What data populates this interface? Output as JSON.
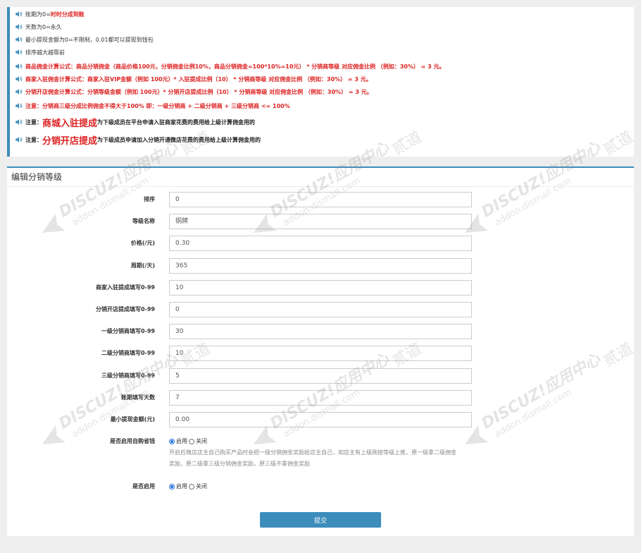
{
  "notices": [
    {
      "parts": [
        {
          "t": "账期为0=",
          "s": "normal"
        },
        {
          "t": "时时分成到账",
          "s": "red"
        }
      ]
    },
    {
      "parts": [
        {
          "t": "天数为0=永久",
          "s": "normal"
        }
      ]
    },
    {
      "parts": [
        {
          "t": "最小提现金额为0=不限制，0.01都可以提现到钱包",
          "s": "normal"
        }
      ]
    },
    {
      "parts": [
        {
          "t": "排序越大越靠前",
          "s": "normal"
        }
      ]
    },
    {
      "parts": [
        {
          "t": "商品佣金计算公式：商品分销佣金（商品价格100元，分销佣金比例10%，商品分销佣金=100*10%=10元） * 分销商等级 对应佣金比例 （例如：30%） = 3 元。",
          "s": "red"
        }
      ]
    },
    {
      "parts": [
        {
          "t": "商家入驻佣金计算公式：商家入驻VIP金额（例如 100元）* 入驻提成比例（10） * 分销商等级 对应佣金比例 （例如：30%） = 3 元。",
          "s": "red"
        }
      ]
    },
    {
      "parts": [
        {
          "t": "分销开店佣金计算公式：分销等级金额（例如 100元）* 分销开店提成比例（10） * 分销商等级 对应佣金比例 （例如：30%） = 3 元。",
          "s": "red"
        }
      ]
    },
    {
      "parts": [
        {
          "t": "注意：分销商三级分成比例佣金不得大于100% 即：一级分销商 + 二级分销商 + 三级分销商 <= 100%",
          "s": "red"
        }
      ]
    },
    {
      "parts": [
        {
          "t": "注意：",
          "s": "dark"
        },
        {
          "t": "商城入驻提成",
          "s": "big"
        },
        {
          "t": "为下级成员在平台申请入驻商家花费的费用给上级计算佣金用的",
          "s": "dark"
        }
      ]
    },
    {
      "parts": [
        {
          "t": "注意：",
          "s": "dark"
        },
        {
          "t": "分销开店提成",
          "s": "big"
        },
        {
          "t": "为下级成员申请加入分销开通微店花费的费用给上级计算佣金用的",
          "s": "dark"
        }
      ]
    }
  ],
  "panel": {
    "title": "编辑分销等级"
  },
  "fields": [
    {
      "label": "排序",
      "value": "0"
    },
    {
      "label": "等级名称",
      "value": "铜牌"
    },
    {
      "label": "价格(/元)",
      "value": "0.30"
    },
    {
      "label": "周期(/天)",
      "value": "365"
    },
    {
      "label": "商家入驻提成填写0-99",
      "value": "10"
    },
    {
      "label": "分销开店提成填写0-99",
      "value": "0"
    },
    {
      "label": "一级分销商填写0-99",
      "value": "30"
    },
    {
      "label": "二级分销商填写0-99",
      "value": "10"
    },
    {
      "label": "三级分销商填写0-99",
      "value": "5"
    },
    {
      "label": "账期填写天数",
      "value": "7"
    },
    {
      "label": "最小提现金额(元)",
      "value": "0.00"
    }
  ],
  "self_buy": {
    "label": "是否启用自购省钱",
    "on_label": "启用",
    "off_label": "关闭",
    "selected": "on",
    "help_line1": "开启后微店店主自己购买产品时会把一级分销佣金奖励给店主自己，如店主有上级刚按等级上推，原一级拿二级佣金",
    "help_line2": "奖励，原二级拿三级分销佣金奖励，原三级不拿佣金奖励"
  },
  "enabled": {
    "label": "是否启用",
    "on_label": "启用",
    "off_label": "关闭",
    "selected": "on"
  },
  "submit_label": "提交",
  "watermark": {
    "brand": "DISCUZ!应用中心",
    "site": "addon.dismall.com",
    "mark": "贰道"
  },
  "colors": {
    "accent": "#3c8dbc",
    "warning": "#dd2222"
  }
}
